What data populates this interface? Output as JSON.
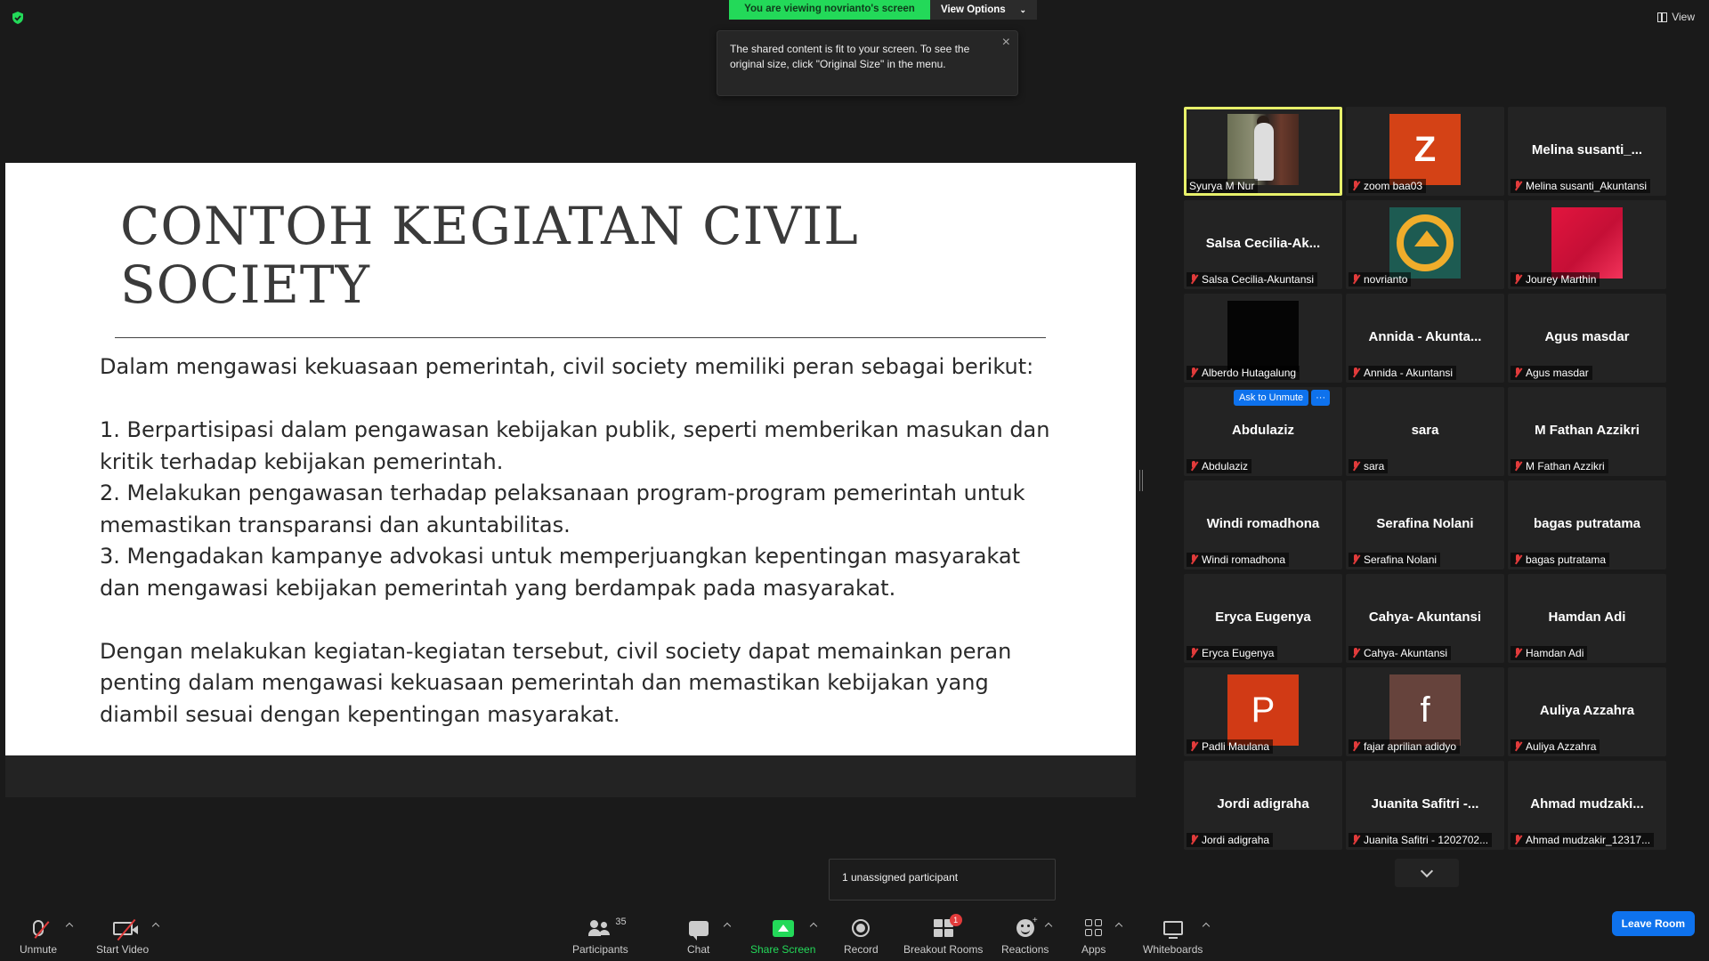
{
  "top": {
    "share_banner": "You are viewing novrianto's screen",
    "view_options": "View Options",
    "view_button": "View"
  },
  "tooltip": {
    "text": "The shared content is fit to your screen. To see the original size, click \"Original Size\" in the menu."
  },
  "slide": {
    "title_line1": "CONTOH KEGIATAN CIVIL",
    "title_line2": "SOCIETY",
    "intro": "Dalam mengawasi kekuasaan pemerintah, civil society memiliki peran sebagai berikut:",
    "point1": "1. Berpartisipasi dalam pengawasan kebijakan publik, seperti memberikan masukan dan kritik terhadap kebijakan pemerintah.",
    "point2": "2. Melakukan pengawasan terhadap pelaksanaan program-program pemerintah untuk memastikan transparansi dan akuntabilitas.",
    "point3": "3. Mengadakan kampanye advokasi untuk memperjuangkan kepentingan masyarakat dan mengawasi kebijakan pemerintah yang berdampak pada masyarakat.",
    "closing": "Dengan melakukan kegiatan-kegiatan tersebut, civil society dapat memainkan peran penting dalam mengawasi kekuasaan pemerintah dan memastikan kebijakan yang diambil sesuai dengan kepentingan masyarakat."
  },
  "gallery": {
    "ask_unmute": "Ask to Unmute",
    "more": "···",
    "tiles": [
      {
        "label": "Syurya M Nur",
        "center": "",
        "avatar": "video",
        "active": true,
        "muted": false
      },
      {
        "label": "zoom baa03",
        "center": "",
        "avatar": "Z"
      },
      {
        "label": "Melina susanti_Akuntansi",
        "center": "Melina  susanti_..."
      },
      {
        "label": "Salsa Cecilia-Akuntansi",
        "center": "Salsa  Cecilia-Ak..."
      },
      {
        "label": "novrianto",
        "center": "",
        "avatar": "logo"
      },
      {
        "label": "Jourey Marthin",
        "center": "",
        "avatar": "red"
      },
      {
        "label": "Alberdo Hutagalung",
        "center": "",
        "avatar": "black"
      },
      {
        "label": "Annida - Akuntansi",
        "center": "Annida  -  Akunta..."
      },
      {
        "label": "Agus masdar",
        "center": "Agus masdar"
      },
      {
        "label": "Abdulaziz",
        "center": "Abdulaziz",
        "ask": true
      },
      {
        "label": "sara",
        "center": "sara"
      },
      {
        "label": "M Fathan Azzikri",
        "center": "M Fathan Azzikri"
      },
      {
        "label": "Windi romadhona",
        "center": "Windi romadhona"
      },
      {
        "label": "Serafina Nolani",
        "center": "Serafina Nolani"
      },
      {
        "label": "bagas putratama",
        "center": "bagas putratama"
      },
      {
        "label": "Eryca Eugenya",
        "center": "Eryca Eugenya"
      },
      {
        "label": "Cahya- Akuntansi",
        "center": "Cahya- Akuntansi"
      },
      {
        "label": "Hamdan Adi",
        "center": "Hamdan Adi"
      },
      {
        "label": "Padli Maulana",
        "center": "",
        "avatar": "P"
      },
      {
        "label": "fajar aprilian adidyo",
        "center": "",
        "avatar": "f"
      },
      {
        "label": "Auliya Azzahra",
        "center": "Auliya Azzahra"
      },
      {
        "label": "Jordi adigraha",
        "center": "Jordi adigraha"
      },
      {
        "label": "Juanita Safitri - 1202702...",
        "center": "Juanita  Safitri  -..."
      },
      {
        "label": "Ahmad mudzakir_12317...",
        "center": "Ahmad  mudzaki..."
      }
    ]
  },
  "unassigned": "1 unassigned participant",
  "toolbar": {
    "unmute": "Unmute",
    "start_video": "Start Video",
    "participants": "Participants",
    "participants_count": "35",
    "chat": "Chat",
    "share_screen": "Share Screen",
    "record": "Record",
    "breakout_rooms": "Breakout Rooms",
    "breakout_badge": "1",
    "reactions": "Reactions",
    "apps": "Apps",
    "whiteboards": "Whiteboards",
    "leave_room": "Leave Room"
  },
  "colors": {
    "share_green": "#23d959",
    "active_speaker": "#e7f06a",
    "leave_blue": "#0e72ed",
    "muted_red": "#e23b3b"
  }
}
